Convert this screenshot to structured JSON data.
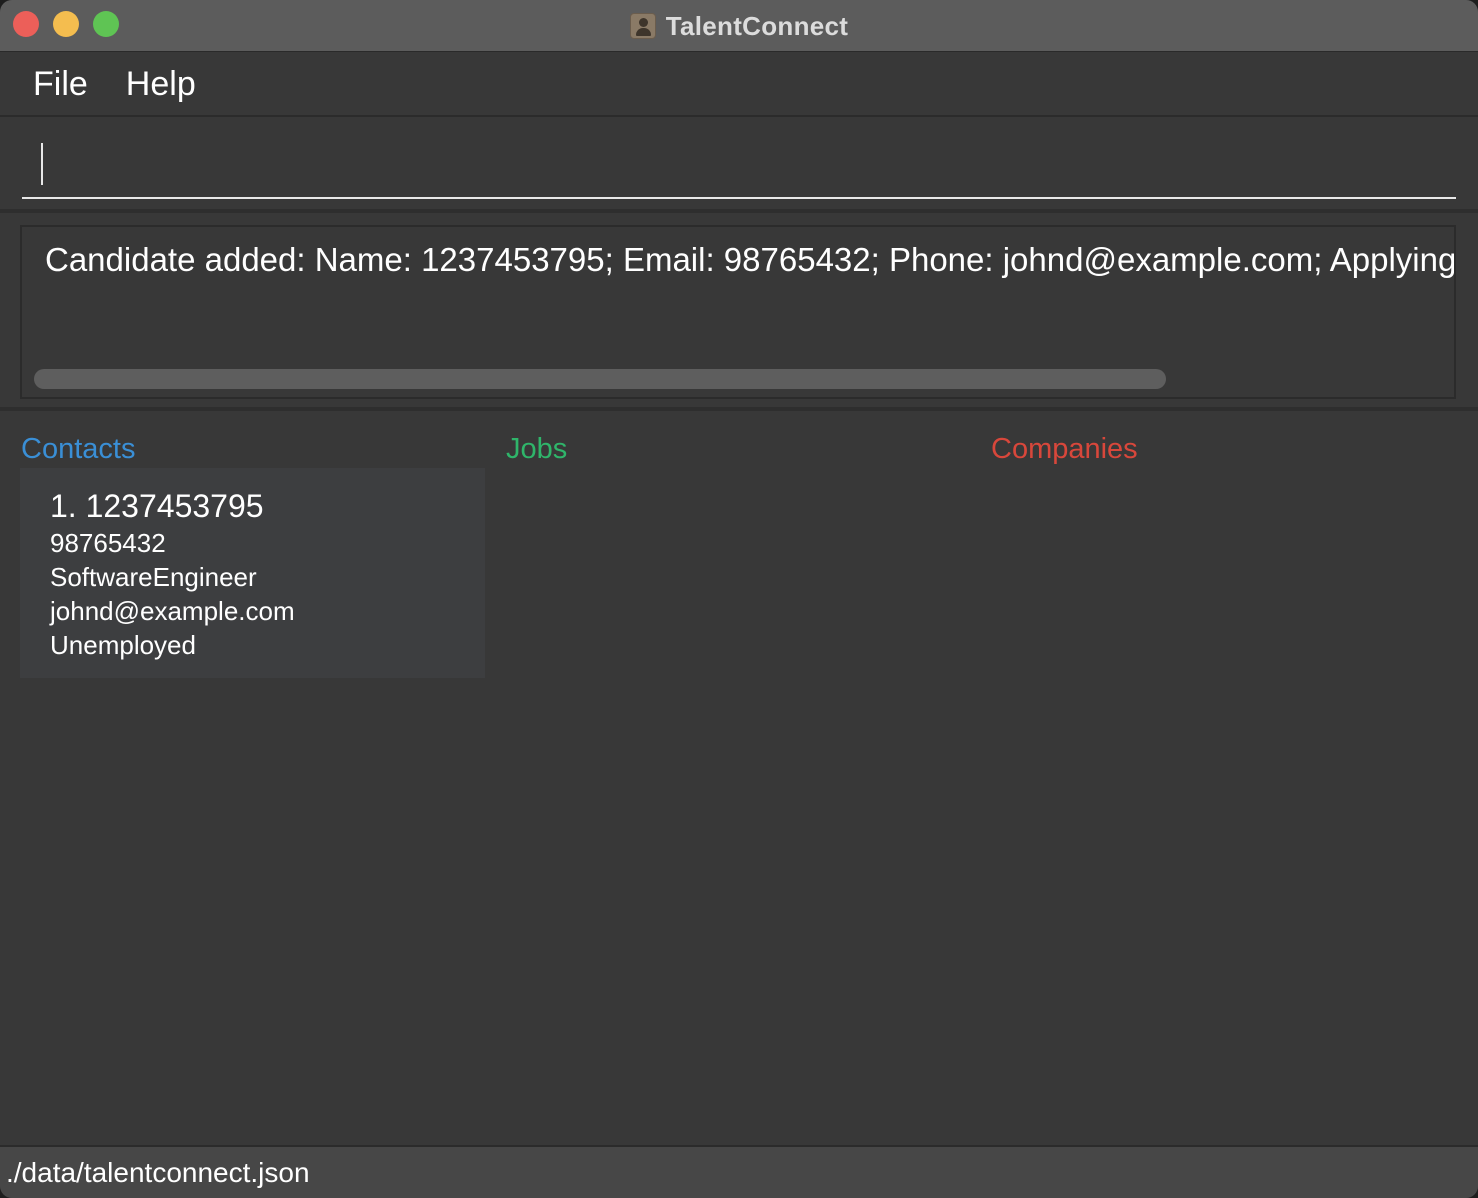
{
  "window": {
    "title": "TalentConnect"
  },
  "menu": {
    "items": [
      {
        "label": "File"
      },
      {
        "label": "Help"
      }
    ]
  },
  "command": {
    "value": "",
    "placeholder": ""
  },
  "result": {
    "text": "Candidate added: Name: 1237453795; Email: 98765432; Phone: johnd@example.com; Applying"
  },
  "panels": {
    "contacts_title": "Contacts",
    "jobs_title": "Jobs",
    "companies_title": "Companies"
  },
  "contacts": [
    {
      "index_name": "1. 1237453795",
      "line1": "98765432",
      "line2": "SoftwareEngineer",
      "line3": "johnd@example.com",
      "line4": "Unemployed"
    }
  ],
  "status": {
    "file_path": "./data/talentconnect.json"
  },
  "colors": {
    "contacts_accent": "#3a8fd6",
    "jobs_accent": "#2fb56a",
    "companies_accent": "#d8473b",
    "background": "#383838"
  }
}
